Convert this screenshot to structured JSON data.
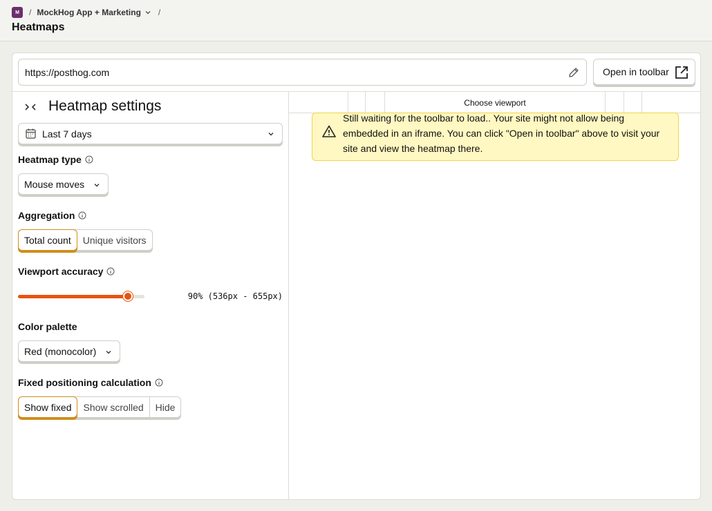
{
  "breadcrumb": {
    "avatar_letter": "M",
    "separator": "/",
    "project": "MockHog App + Marketing",
    "trailing_separator": "/"
  },
  "page": {
    "title": "Heatmaps"
  },
  "url_bar": {
    "value": "https://posthog.com"
  },
  "toolbar_button": {
    "label": "Open in toolbar"
  },
  "sidebar": {
    "title": "Heatmap settings",
    "date_range": "Last 7 days",
    "heatmap_type": {
      "label": "Heatmap type",
      "value": "Mouse moves"
    },
    "aggregation": {
      "label": "Aggregation",
      "options": [
        "Total count",
        "Unique visitors"
      ],
      "selected": "Total count"
    },
    "viewport_accuracy": {
      "label": "Viewport accuracy",
      "value_text": "90% (536px - 655px)",
      "fraction": 0.87
    },
    "color_palette": {
      "label": "Color palette",
      "value": "Red (monocolor)"
    },
    "fixed_positioning": {
      "label": "Fixed positioning calculation",
      "options": [
        "Show fixed",
        "Show scrolled",
        "Hide"
      ],
      "selected": "Show fixed"
    }
  },
  "viewport_bar": {
    "label": "Choose viewport"
  },
  "warning": {
    "text": "Still waiting for the toolbar to load.. Your site might not allow being embedded in an iframe. You can click \"Open in toolbar\" above to visit your site and view the heatmap there."
  },
  "colors": {
    "accent": "#e8530e",
    "active_border": "#d08e1b",
    "warning_bg": "#fff8c2",
    "avatar": "#6d2f6d"
  }
}
